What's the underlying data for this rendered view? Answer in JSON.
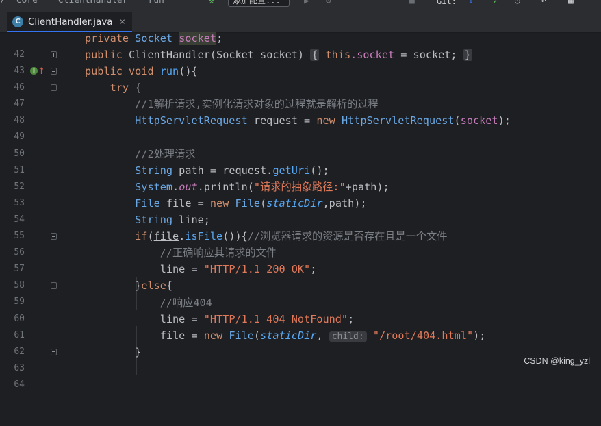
{
  "toolbar": {
    "breadcrumbs": [
      "/",
      "core",
      "ClientHandler",
      "run"
    ],
    "run_config": "添加配置...",
    "git_label": "Git:"
  },
  "tab": {
    "icon": "C",
    "label": "ClientHandler.java"
  },
  "lines": [
    {
      "num": "42"
    },
    {
      "num": "43"
    },
    {
      "num": "46"
    },
    {
      "num": "47"
    },
    {
      "num": "48"
    },
    {
      "num": "49"
    },
    {
      "num": "50"
    },
    {
      "num": "51"
    },
    {
      "num": "52"
    },
    {
      "num": "53"
    },
    {
      "num": "54"
    },
    {
      "num": "55"
    },
    {
      "num": "56"
    },
    {
      "num": "57"
    },
    {
      "num": "58"
    },
    {
      "num": "59"
    },
    {
      "num": "60"
    },
    {
      "num": "61"
    },
    {
      "num": "62"
    },
    {
      "num": "63"
    },
    {
      "num": "64"
    }
  ],
  "code": {
    "l42": {
      "kw": "private",
      "type": "Socket",
      "field": "socket",
      "end": ";"
    },
    "l43": {
      "kw": "public",
      "name": "ClientHandler",
      "params": "(Socket socket)",
      "folded": "{",
      "this": "this",
      "dotfield": ".socket",
      "assign": " = socket;",
      "close": "}"
    },
    "l46": {
      "kw1": "public",
      "kw2": "void",
      "name": "run",
      "rest": "(){"
    },
    "l47": {
      "kw": "try",
      "rest": " {"
    },
    "l48": {
      "comment": "//1解析请求,实例化请求对象的过程就是解析的过程"
    },
    "l49": {
      "type": "HttpServletRequest",
      "mid": " request = ",
      "kw": "new",
      "type2": "HttpServletRequest",
      "open": "(",
      "arg": "socket",
      "close": ");"
    },
    "l51": {
      "comment": "//2处理请求"
    },
    "l52": {
      "type": "String",
      "mid": " path = request.",
      "method": "getUri",
      "end": "();"
    },
    "l53": {
      "type": "System",
      "dot": ".",
      "out": "out",
      "mid": ".println(",
      "str": "\"请求的抽象路径:\"",
      "end": "+path);"
    },
    "l54": {
      "type": "File",
      "var": "file",
      "mid": " = ",
      "kw": "new",
      "type2": "File",
      "open": "(",
      "sfield": "staticDir",
      "end": ",path);"
    },
    "l55": {
      "type": "String",
      "end": " line;"
    },
    "l56": {
      "kw": "if",
      "open": "(",
      "var": "file",
      "dot": ".",
      "method": "isFile",
      "end": "()){",
      "comment": "//浏览器请求的资源是否存在且是一个文件"
    },
    "l57": {
      "comment": "//正确响应其请求的文件"
    },
    "l58": {
      "start": "line = ",
      "str": "\"HTTP/1.1 200 OK\"",
      "end": ";"
    },
    "l59": {
      "start": "}",
      "kw": "else",
      "end": "{"
    },
    "l60": {
      "comment": "//响应404"
    },
    "l61": {
      "start": "line = ",
      "str": "\"HTTP/1.1 404 NotFound\"",
      "end": ";"
    },
    "l62": {
      "var": "file",
      "mid": " = ",
      "kw": "new",
      "type": "File",
      "open": "(",
      "sfield": "staticDir",
      "comma": ",",
      "hint": "child:",
      "str": "\"/root/404.html\"",
      "end": ");"
    },
    "l63": {
      "end": "}"
    }
  },
  "watermark": "CSDN @king_yzl",
  "colors": {
    "background": "#1e1f22",
    "keyword": "#cf8e6d",
    "string": "#6aab73",
    "comment": "#7a7e85",
    "field": "#c77dbb",
    "method": "#56a8f5"
  }
}
